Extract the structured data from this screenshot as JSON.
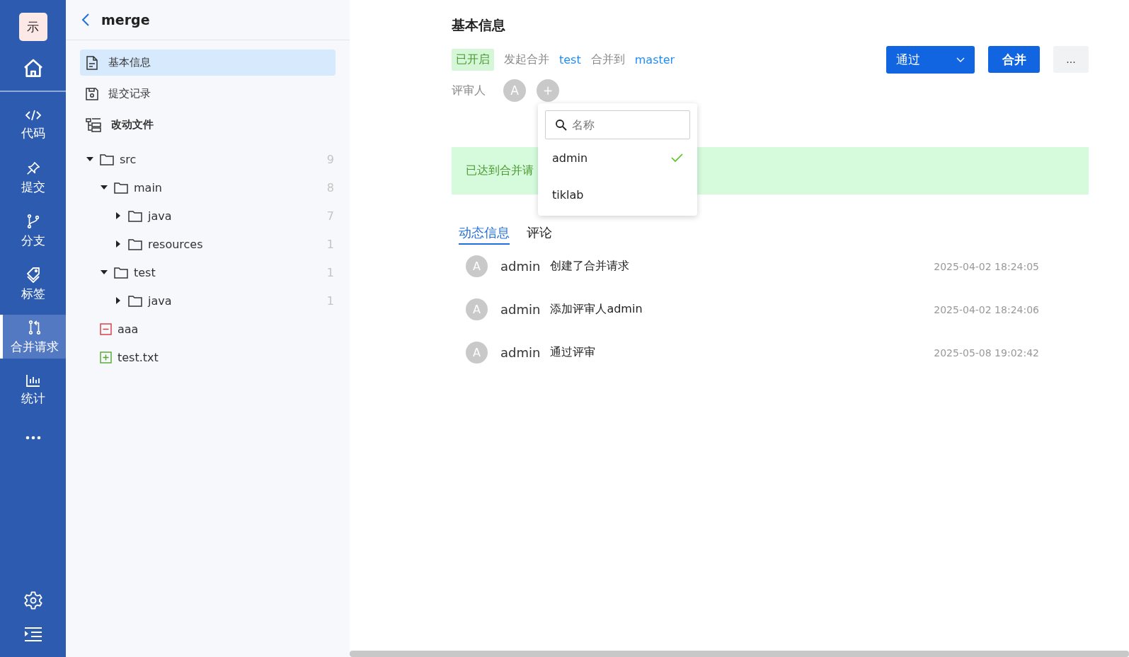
{
  "app_logo": "示",
  "nav": {
    "items": [
      {
        "kind": "home",
        "selected": false
      },
      {
        "kind": "code",
        "label": "代码",
        "selected": false
      },
      {
        "kind": "commit",
        "label": "提交",
        "selected": false
      },
      {
        "kind": "branch",
        "label": "分支",
        "selected": false
      },
      {
        "kind": "tag",
        "label": "标签",
        "selected": false
      },
      {
        "kind": "merge",
        "label": "合并请求",
        "selected": true
      },
      {
        "kind": "stats",
        "label": "统计",
        "selected": false
      },
      {
        "kind": "more",
        "selected": false
      }
    ],
    "bottom": [
      {
        "kind": "settings"
      },
      {
        "kind": "collapse"
      }
    ]
  },
  "side_panel": {
    "title": "merge",
    "menu": [
      {
        "kind": "info",
        "label": "基本信息",
        "selected": true
      },
      {
        "kind": "commits",
        "label": "提交记录",
        "selected": false
      },
      {
        "kind": "files",
        "label": "改动文件",
        "selected": false
      }
    ],
    "tree": [
      {
        "kind": "folder",
        "name": "src",
        "count": "9",
        "expanded": true,
        "children": [
          {
            "kind": "folder",
            "name": "main",
            "count": "8",
            "expanded": true,
            "children": [
              {
                "kind": "folder",
                "name": "java",
                "count": "7",
                "expanded": false
              },
              {
                "kind": "folder",
                "name": "resources",
                "count": "1",
                "expanded": false
              }
            ]
          },
          {
            "kind": "folder",
            "name": "test",
            "count": "1",
            "expanded": true,
            "children": [
              {
                "kind": "folder",
                "name": "java",
                "count": "1",
                "expanded": false
              }
            ]
          }
        ]
      },
      {
        "kind": "deleted",
        "name": "aaa"
      },
      {
        "kind": "added",
        "name": "test.txt"
      }
    ]
  },
  "main": {
    "title": "基本信息",
    "status": "已开启",
    "source_label": "发起合并",
    "source_branch": "test",
    "target_label": "合并到",
    "target_branch": "master",
    "review_button": "通过",
    "merge_button": "合并",
    "more_button": "...",
    "reviewers_label": "评审人",
    "reviewers": [
      "A"
    ],
    "add_reviewer": "+",
    "banner": "已达到合并请",
    "tabs": [
      {
        "label": "动态信息",
        "selected": true
      },
      {
        "label": "评论",
        "selected": false
      }
    ],
    "activities": [
      {
        "avatar": "A",
        "user": "admin",
        "action": "创建了合并请求",
        "time": "2025-04-02 18:24:05"
      },
      {
        "avatar": "A",
        "user": "admin",
        "action": "添加评审人admin",
        "time": "2025-04-02 18:24:06"
      },
      {
        "avatar": "A",
        "user": "admin",
        "action": "通过评审",
        "time": "2025-05-08 19:02:42"
      }
    ]
  },
  "reviewer_dropdown": {
    "placeholder": "名称",
    "options": [
      {
        "name": "admin",
        "checked": true
      },
      {
        "name": "tiklab",
        "checked": false
      }
    ]
  }
}
